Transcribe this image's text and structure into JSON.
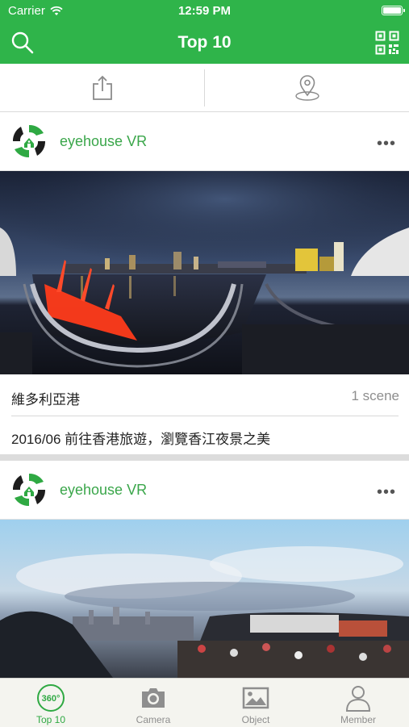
{
  "status_bar": {
    "carrier": "Carrier",
    "time": "12:59 PM"
  },
  "nav": {
    "title": "Top 10"
  },
  "feed": [
    {
      "author": "eyehouse VR",
      "title": "維多利亞港",
      "scenes": "1 scene",
      "description": "2016/06 前往香港旅遊，瀏覽香江夜景之美"
    },
    {
      "author": "eyehouse VR"
    }
  ],
  "tabs": [
    {
      "label": "Top 10",
      "icon": "360-icon",
      "active": true
    },
    {
      "label": "Camera",
      "icon": "camera-icon"
    },
    {
      "label": "Object",
      "icon": "image-icon"
    },
    {
      "label": "Member",
      "icon": "person-icon"
    }
  ],
  "colors": {
    "brand": "#2fb44a",
    "tab_active": "#2fa943"
  }
}
